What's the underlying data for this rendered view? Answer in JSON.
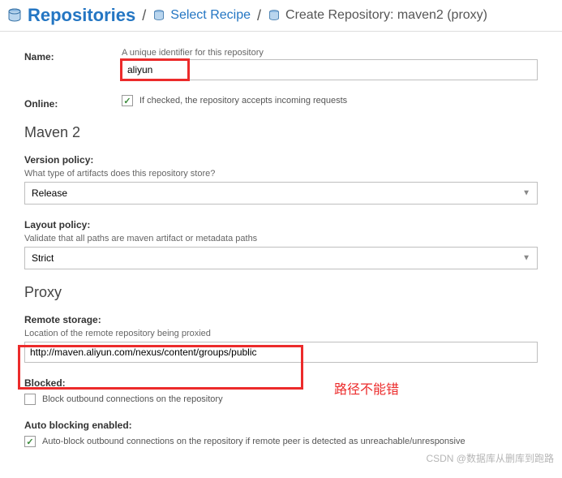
{
  "breadcrumb": {
    "item1": "Repositories",
    "item2": "Select Recipe",
    "item3": "Create Repository: maven2 (proxy)"
  },
  "form": {
    "name_label": "Name:",
    "name_hint": "A unique identifier for this repository",
    "name_value": "aliyun",
    "online_label": "Online:",
    "online_text": "If checked, the repository accepts incoming requests"
  },
  "maven": {
    "title": "Maven 2",
    "version_label": "Version policy:",
    "version_hint": "What type of artifacts does this repository store?",
    "version_value": "Release",
    "layout_label": "Layout policy:",
    "layout_hint": "Validate that all paths are maven artifact or metadata paths",
    "layout_value": "Strict"
  },
  "proxy": {
    "title": "Proxy",
    "remote_label": "Remote storage:",
    "remote_hint": "Location of the remote repository being proxied",
    "remote_value": "http://maven.aliyun.com/nexus/content/groups/public",
    "blocked_label": "Blocked:",
    "blocked_text": "Block outbound connections on the repository",
    "auto_label": "Auto blocking enabled:",
    "auto_text": "Auto-block outbound connections on the repository if remote peer is detected as unreachable/unresponsive"
  },
  "annotation": {
    "text": "路径不能错",
    "watermark": "CSDN @数据库从删库到跑路"
  }
}
